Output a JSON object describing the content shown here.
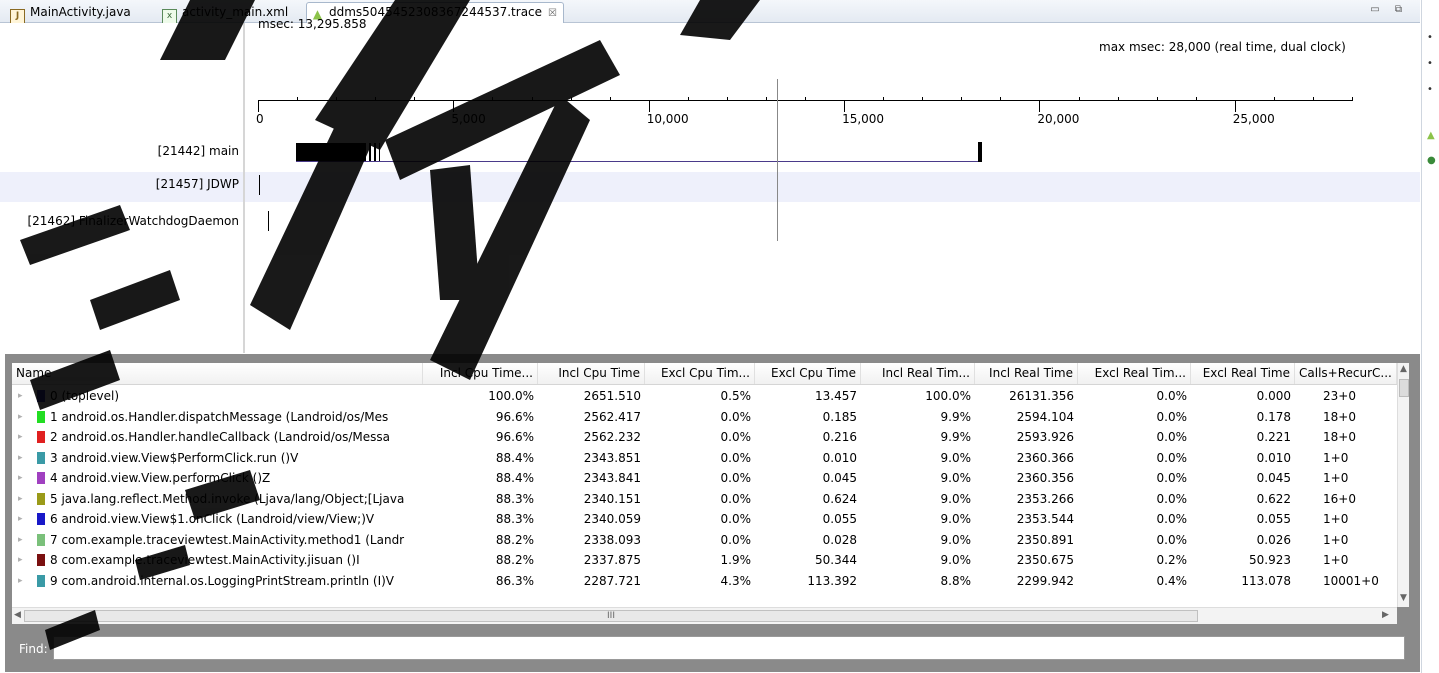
{
  "tabs": [
    {
      "label": "MainActivity.java",
      "icon": "java-file-icon"
    },
    {
      "label": "activity_main.xml",
      "icon": "xml-file-icon"
    },
    {
      "label": "ddms5045452308367244537.trace",
      "icon": "android-icon",
      "close": "☒"
    }
  ],
  "window_buttons": "▭ ⧉",
  "timeline": {
    "msec_label": "msec: 13,295.858",
    "max_label": "max msec: 28,000 (real time, dual clock)",
    "ticks": [
      {
        "label": "0",
        "value": 0
      },
      {
        "label": "5,000",
        "value": 5000
      },
      {
        "label": "10,000",
        "value": 10000
      },
      {
        "label": "15,000",
        "value": 15000
      },
      {
        "label": "20,000",
        "value": 20000
      },
      {
        "label": "25,000",
        "value": 25000
      }
    ],
    "max_value": 28000,
    "cursor_value": 13295.858,
    "threads": [
      {
        "label": "[21442] main"
      },
      {
        "label": "[21457] JDWP"
      },
      {
        "label": "[21462] FinalizerWatchdogDaemon"
      }
    ]
  },
  "table": {
    "columns": [
      "Name",
      "Incl Cpu Time...",
      "Incl Cpu Time",
      "Excl Cpu Tim...",
      "Excl Cpu Time",
      "Incl Real Tim...",
      "Incl Real Time",
      "Excl Real Tim...",
      "Excl Real Time",
      "Calls+RecurC..."
    ],
    "rows": [
      {
        "name": "0 (toplevel)",
        "color": "#3f3fbf",
        "v": [
          "100.0%",
          "2651.510",
          "0.5%",
          "13.457",
          "100.0%",
          "26131.356",
          "0.0%",
          "0.000",
          "23+0"
        ]
      },
      {
        "name": "1 android.os.Handler.dispatchMessage (Landroid/os/Mes",
        "color": "#22dd22",
        "v": [
          "96.6%",
          "2562.417",
          "0.0%",
          "0.185",
          "9.9%",
          "2594.104",
          "0.0%",
          "0.178",
          "18+0"
        ]
      },
      {
        "name": "2 android.os.Handler.handleCallback (Landroid/os/Messa",
        "color": "#e02020",
        "v": [
          "96.6%",
          "2562.232",
          "0.0%",
          "0.216",
          "9.9%",
          "2593.926",
          "0.0%",
          "0.221",
          "18+0"
        ]
      },
      {
        "name": "3 android.view.View$PerformClick.run ()V",
        "color": "#3a9aa6",
        "v": [
          "88.4%",
          "2343.851",
          "0.0%",
          "0.010",
          "9.0%",
          "2360.366",
          "0.0%",
          "0.010",
          "1+0"
        ]
      },
      {
        "name": "4 android.view.View.performClick ()Z",
        "color": "#a040c0",
        "v": [
          "88.4%",
          "2343.841",
          "0.0%",
          "0.045",
          "9.0%",
          "2360.356",
          "0.0%",
          "0.045",
          "1+0"
        ]
      },
      {
        "name": "5 java.lang.reflect.Method.invoke (Ljava/lang/Object;[Ljava",
        "color": "#9a9a18",
        "v": [
          "88.3%",
          "2340.151",
          "0.0%",
          "0.624",
          "9.0%",
          "2353.266",
          "0.0%",
          "0.622",
          "16+0"
        ]
      },
      {
        "name": "6 android.view.View$1.onClick (Landroid/view/View;)V",
        "color": "#1818c8",
        "v": [
          "88.3%",
          "2340.059",
          "0.0%",
          "0.055",
          "9.0%",
          "2353.544",
          "0.0%",
          "0.055",
          "1+0"
        ]
      },
      {
        "name": "7 com.example.traceviewtest.MainActivity.method1 (Landr",
        "color": "#7ac07a",
        "v": [
          "88.2%",
          "2338.093",
          "0.0%",
          "0.028",
          "9.0%",
          "2350.891",
          "0.0%",
          "0.026",
          "1+0"
        ]
      },
      {
        "name": "8 com.example.traceviewtest.MainActivity.jisuan ()I",
        "color": "#7a1010",
        "v": [
          "88.2%",
          "2337.875",
          "1.9%",
          "50.344",
          "9.0%",
          "2350.675",
          "0.2%",
          "50.923",
          "1+0"
        ]
      },
      {
        "name": "9 com.android.internal.os.LoggingPrintStream.println (I)V",
        "color": "#3a9aa6",
        "v": [
          "86.3%",
          "2287.721",
          "4.3%",
          "113.392",
          "8.8%",
          "2299.942",
          "0.4%",
          "113.078",
          "10001+0"
        ]
      }
    ]
  },
  "scroll": {
    "thumb_grip": "III"
  },
  "find": {
    "label": "Find:",
    "value": ""
  },
  "colors": {
    "panel": "#8a8a8a",
    "row_band": "#eef0fb",
    "timeline_bar": "#000000",
    "timeline_line": "#4a3a8a"
  }
}
